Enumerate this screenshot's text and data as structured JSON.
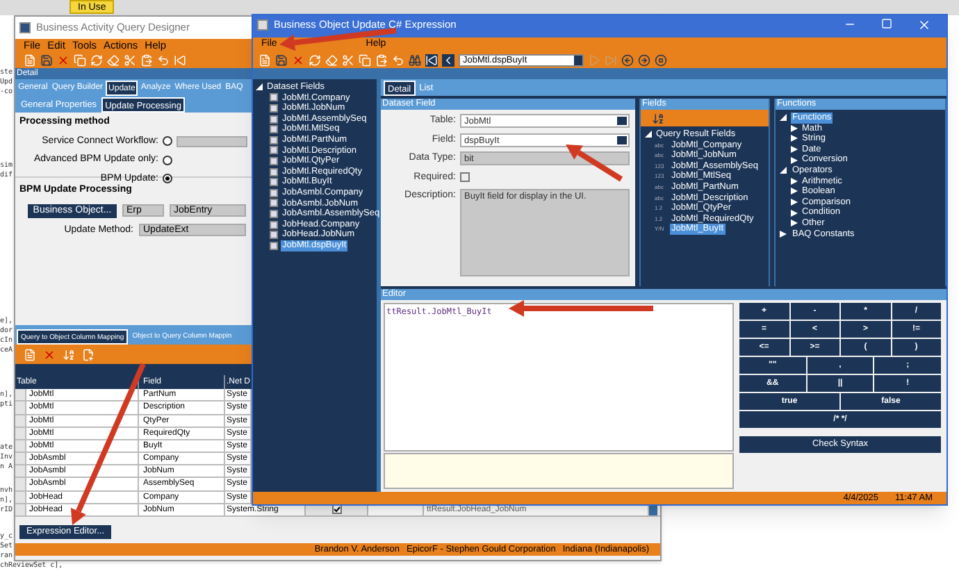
{
  "desktop": {
    "badge": "In Use",
    "code_blocks": [
      [
        "ste",
        "Upd",
        "-co"
      ],
      [
        "sim",
        "dif"
      ],
      [
        "e],",
        "dor",
        "cIn",
        "ceA"
      ],
      [
        "n],",
        "pti"
      ],
      [
        "ate",
        "Inv",
        "n A"
      ],
      [
        "nvh",
        "n],",
        "rID"
      ],
      [
        "y_c",
        "Set",
        "ran",
        "chReviewSet c],"
      ]
    ]
  },
  "query_designer": {
    "title": "Business Activity Query Designer",
    "menu": [
      "File",
      "Edit",
      "Tools",
      "Actions",
      "Help"
    ],
    "detail_label": "Detail",
    "tabs": [
      {
        "label": "General",
        "selected": false
      },
      {
        "label": "Query Builder",
        "selected": false
      },
      {
        "label": "Update",
        "selected": true
      },
      {
        "label": "Analyze",
        "selected": false
      },
      {
        "label": "Where Used",
        "selected": false
      },
      {
        "label": "BAQ",
        "selected": false
      }
    ],
    "subtabs": [
      {
        "label": "General Properties",
        "selected": false
      },
      {
        "label": "Update Processing",
        "selected": true
      }
    ],
    "processing_method": {
      "title": "Processing method",
      "options": [
        {
          "label": "Service Connect Workflow:",
          "selected": false
        },
        {
          "label": "Advanced BPM Update only:",
          "selected": false
        },
        {
          "label": "BPM Update:",
          "selected": true
        }
      ]
    },
    "bpm": {
      "title": "BPM Update Processing",
      "button": "Business Object...",
      "system": "Erp",
      "object": "JobEntry",
      "method_label": "Update Method:",
      "method": "UpdateExt"
    },
    "mapping_tabs": [
      {
        "label": "Query to Object Column Mapping",
        "selected": true
      },
      {
        "label": "Object to Query Column Mappin",
        "selected": false
      }
    ],
    "table": {
      "columns": [
        "Table",
        "Field",
        ".Net D"
      ],
      "rows": [
        {
          "table": "JobMtl",
          "field": "PartNum",
          "type": "Syste"
        },
        {
          "table": "JobMtl",
          "field": "Description",
          "type": "Syste"
        },
        {
          "table": "JobMtl",
          "field": "QtyPer",
          "type": "Syste"
        },
        {
          "table": "JobMtl",
          "field": "RequiredQty",
          "type": "Syste"
        },
        {
          "table": "JobMtl",
          "field": "BuyIt",
          "type": "Syste"
        },
        {
          "table": "JobAsmbl",
          "field": "Company",
          "type": "Syste"
        },
        {
          "table": "JobAsmbl",
          "field": "JobNum",
          "type": "Syste"
        },
        {
          "table": "JobAsmbl",
          "field": "AssemblySeq",
          "type": "Syste"
        },
        {
          "table": "JobHead",
          "field": "Company",
          "type": "Syste"
        },
        {
          "table": "JobHead",
          "field": "JobNum",
          "type": "System.String",
          "checked": true,
          "expression": "ttResult.JobHead_JobNum"
        }
      ]
    },
    "expression_button": "Expression Editor...",
    "status": [
      "Brandon V. Anderson",
      "EpicorF - Stephen Gould Corporation",
      "Indiana (Indianapolis)"
    ]
  },
  "expression_window": {
    "title": "Business Object Update C# Expression",
    "menu": [
      "File",
      "Help"
    ],
    "navigator": "JobMtl.dspBuyIt",
    "tree": {
      "label": "Dataset Fields",
      "expanded": true,
      "children": [
        {
          "label": "JobMtl.Company",
          "selected": false
        },
        {
          "label": "JobMtl.JobNum",
          "selected": false
        },
        {
          "label": "JobMtl.AssemblySeq",
          "selected": false
        },
        {
          "label": "JobMtl.MtlSeq",
          "selected": false
        },
        {
          "label": "JobMtl.PartNum",
          "selected": false
        },
        {
          "label": "JobMtl.Description",
          "selected": false
        },
        {
          "label": "JobMtl.QtyPer",
          "selected": false
        },
        {
          "label": "JobMtl.RequiredQty",
          "selected": false
        },
        {
          "label": "JobMtl.BuyIt",
          "selected": false
        },
        {
          "label": "JobAsmbl.Company",
          "selected": false
        },
        {
          "label": "JobAsmbl.JobNum",
          "selected": false
        },
        {
          "label": "JobAsmbl.AssemblySeq",
          "selected": false
        },
        {
          "label": "JobHead.Company",
          "selected": false
        },
        {
          "label": "JobHead.JobNum",
          "selected": false
        },
        {
          "label": "JobMtl.dspBuyIt",
          "selected": true
        }
      ]
    },
    "tabs": [
      {
        "label": "Detail",
        "selected": true
      },
      {
        "label": "List",
        "selected": false
      }
    ],
    "dataset_field": {
      "title": "Dataset Field",
      "table_label": "Table:",
      "table": "JobMtl",
      "field_label": "Field:",
      "field": "dspBuyIt",
      "data_type_label": "Data Type:",
      "data_type": "bit",
      "required_label": "Required:",
      "required": false,
      "description_label": "Description:",
      "description": "BuyIt field for display in the UI."
    },
    "fields": {
      "title": "Fields",
      "group": "Query Result Fields",
      "expanded": true,
      "items": [
        {
          "type": "abc",
          "name": "JobMtl_Company",
          "selected": false
        },
        {
          "type": "abc",
          "name": "JobMtl_JobNum",
          "selected": false
        },
        {
          "type": "123",
          "name": "JobMtl_AssemblySeq",
          "selected": false
        },
        {
          "type": "123",
          "name": "JobMtl_MtlSeq",
          "selected": false
        },
        {
          "type": "abc",
          "name": "JobMtl_PartNum",
          "selected": false
        },
        {
          "type": "abc",
          "name": "JobMtl_Description",
          "selected": false
        },
        {
          "type": "1.2",
          "name": "JobMtl_QtyPer",
          "selected": false
        },
        {
          "type": "1.2",
          "name": "JobMtl_RequiredQty",
          "selected": false
        },
        {
          "type": "Y/N",
          "name": "JobMtl_BuyIt",
          "selected": true
        }
      ]
    },
    "functions": {
      "title": "Functions",
      "tree": [
        {
          "label": "Functions",
          "selected": true,
          "expanded": true,
          "children": [
            {
              "label": "Math",
              "expanded": false
            },
            {
              "label": "String",
              "expanded": false
            },
            {
              "label": "Date",
              "expanded": false
            },
            {
              "label": "Conversion",
              "expanded": false
            }
          ]
        },
        {
          "label": "Operators",
          "selected": false,
          "expanded": true,
          "children": [
            {
              "label": "Arithmetic",
              "expanded": false
            },
            {
              "label": "Boolean",
              "expanded": false
            },
            {
              "label": "Comparison",
              "expanded": false
            },
            {
              "label": "Condition",
              "expanded": false
            },
            {
              "label": "Other",
              "expanded": false
            }
          ]
        },
        {
          "label": "BAQ Constants",
          "selected": false,
          "expanded": false
        }
      ]
    },
    "editor": {
      "title": "Editor",
      "text": "ttResult.JobMtl_BuyIt",
      "keys": [
        "+",
        "-",
        "*",
        "/",
        "=",
        "<",
        ">",
        "!=",
        "<=",
        ">=",
        "(",
        ")",
        "\"\"",
        ",",
        ";",
        "&&",
        "||",
        "!",
        "true",
        "false",
        "/* */"
      ],
      "check_button": "Check Syntax"
    },
    "status": [
      "4/4/2025",
      "11:47 AM"
    ]
  }
}
